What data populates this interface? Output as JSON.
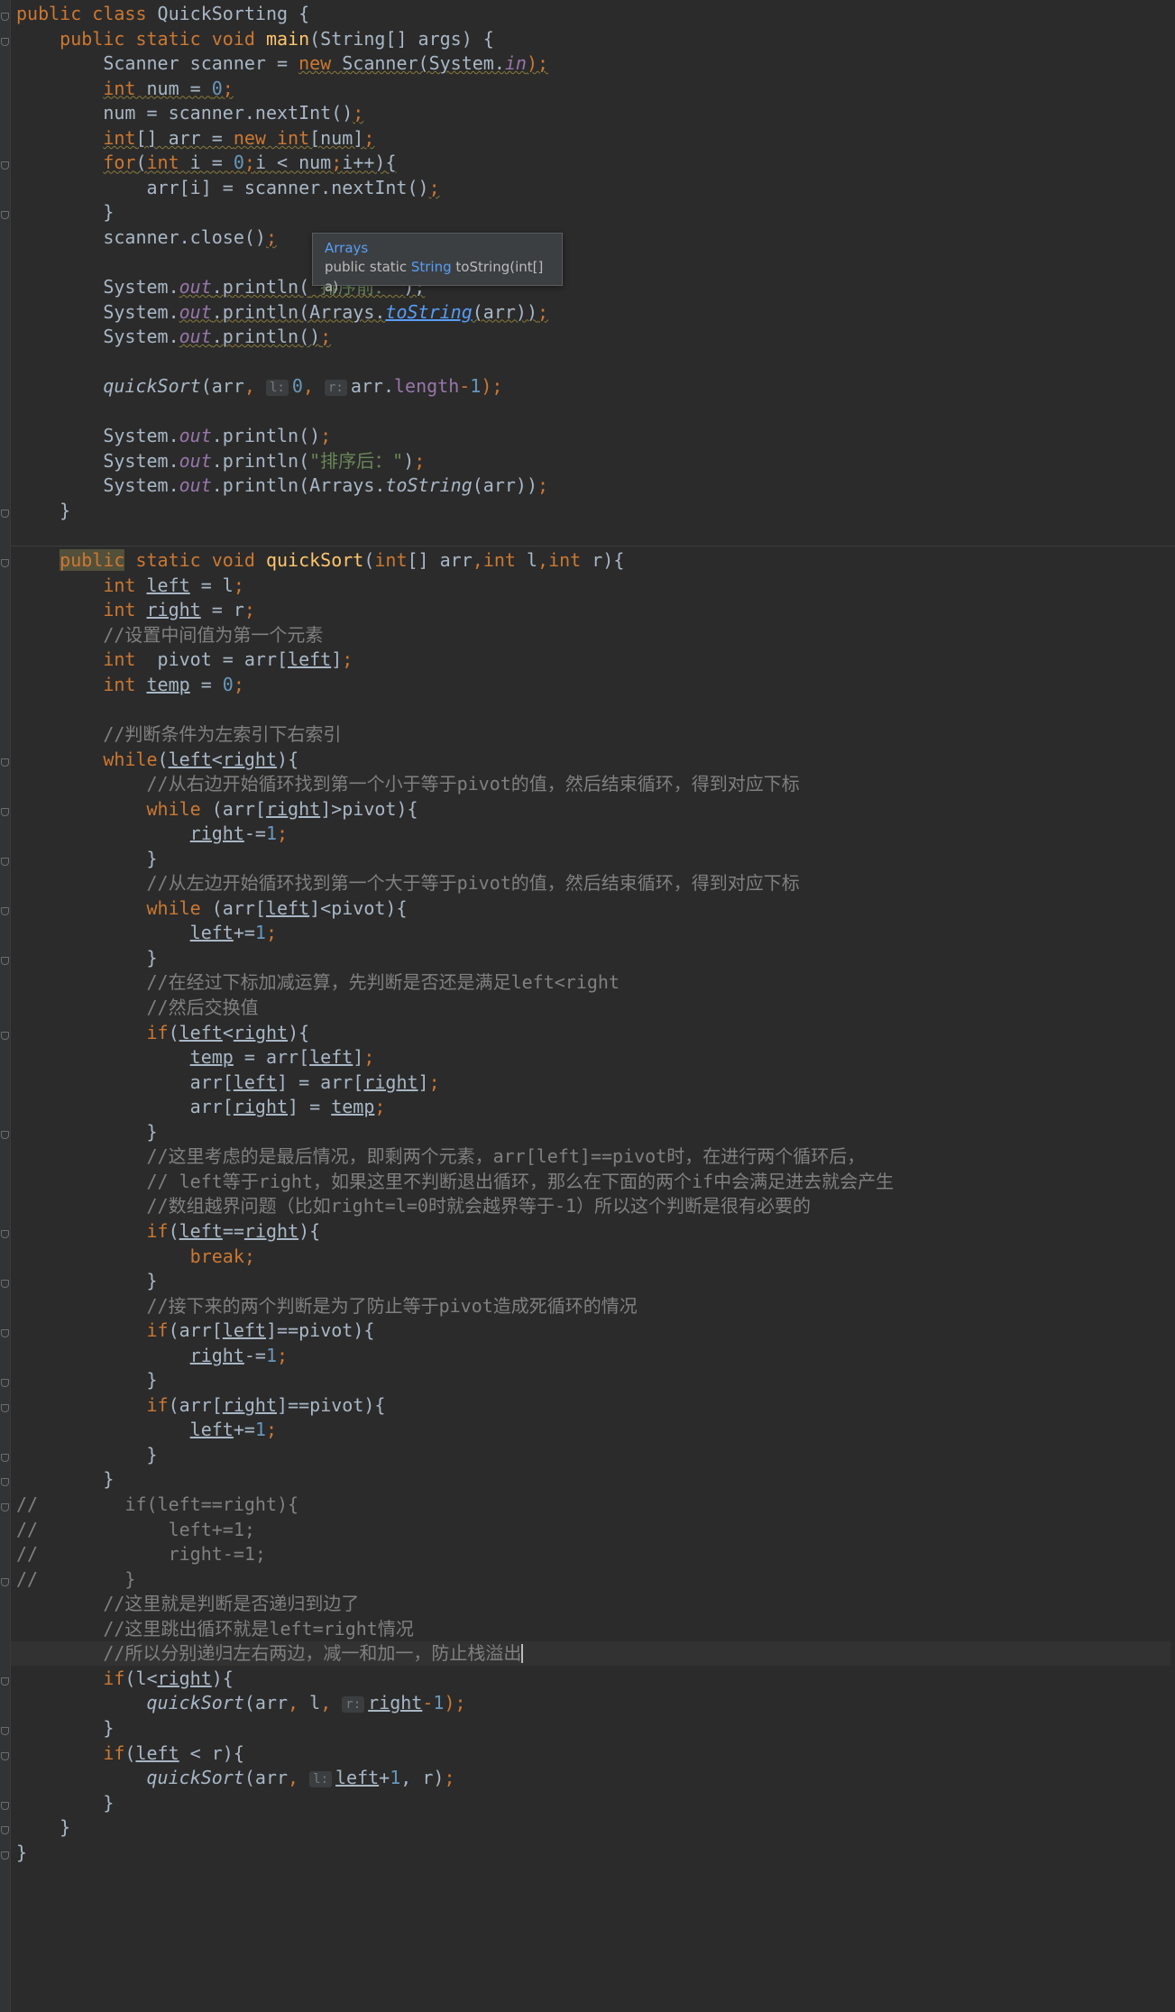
{
  "tooltip": {
    "title": "Arrays",
    "signature_prefix": "public static ",
    "return_type": "String",
    "signature_rest": " toString(int[] a)"
  },
  "gutter_fold_markers": 38,
  "lines": [
    [
      [
        "public class ",
        "kw"
      ],
      [
        "QuickSorting {",
        ""
      ]
    ],
    [
      [
        "    public static void ",
        "kw"
      ],
      [
        "main",
        "fn"
      ],
      [
        "(String[] args) {",
        ""
      ]
    ],
    [
      [
        "        Scanner scanner = ",
        ""
      ],
      [
        "new ",
        "kw"
      ],
      [
        "Scanner(System.",
        ""
      ],
      [
        "in",
        "st"
      ],
      [
        ");",
        "kw"
      ]
    ],
    [
      [
        "        ",
        ""
      ],
      [
        "int ",
        "kw"
      ],
      [
        "num = ",
        ""
      ],
      [
        "0",
        "num"
      ],
      [
        ";",
        "kw"
      ]
    ],
    [
      [
        "        num = scanner.nextInt()",
        ""
      ],
      [
        ";",
        "kw"
      ]
    ],
    [
      [
        "        ",
        ""
      ],
      [
        "int",
        "kw"
      ],
      [
        "[] arr = ",
        ""
      ],
      [
        "new int",
        "kw"
      ],
      [
        "[num]",
        ""
      ],
      [
        ";",
        "kw"
      ]
    ],
    [
      [
        "        ",
        ""
      ],
      [
        "for",
        "kw"
      ],
      [
        "(",
        ""
      ],
      [
        "int ",
        "kw"
      ],
      [
        "i = ",
        ""
      ],
      [
        "0",
        "num"
      ],
      [
        ";",
        "kw"
      ],
      [
        "i < num",
        ""
      ],
      [
        ";",
        "kw"
      ],
      [
        "i++){",
        ""
      ]
    ],
    [
      [
        "            arr[i] = scanner.nextInt()",
        ""
      ],
      [
        ";",
        "kw"
      ]
    ],
    [
      [
        "        }",
        ""
      ]
    ],
    [
      [
        "        scanner.close()",
        ""
      ],
      [
        ";",
        "kw"
      ]
    ],
    [],
    [
      [
        "        System.",
        ""
      ],
      [
        "out",
        "st"
      ],
      [
        ".println(",
        ""
      ],
      [
        "\"排序前：\"",
        "str"
      ],
      [
        ");",
        ""
      ]
    ],
    [
      [
        "        System.",
        ""
      ],
      [
        "out",
        "st"
      ],
      [
        ".println(Arrays.",
        ""
      ],
      [
        "toString",
        "linkfn"
      ],
      [
        "(arr))",
        ""
      ],
      [
        ";",
        "kw"
      ]
    ],
    [
      [
        "        System.",
        ""
      ],
      [
        "out",
        "st"
      ],
      [
        ".println()",
        ""
      ],
      [
        ";",
        "kw"
      ]
    ],
    [],
    [
      [
        "        ",
        ""
      ],
      [
        "quickSort",
        "it"
      ],
      [
        "(arr",
        ""
      ],
      [
        ", ",
        "kw"
      ],
      [
        "l:",
        "hint"
      ],
      [
        "0",
        "num"
      ],
      [
        ", ",
        "kw"
      ],
      [
        "r:",
        "hint"
      ],
      [
        "arr.",
        ""
      ],
      [
        "length",
        "fld"
      ],
      [
        "-",
        "kw"
      ],
      [
        "1",
        "num"
      ],
      [
        ");",
        "kw"
      ]
    ],
    [],
    [
      [
        "        System.",
        ""
      ],
      [
        "out",
        "st"
      ],
      [
        ".println()",
        ""
      ],
      [
        ";",
        "kw"
      ]
    ],
    [
      [
        "        System.",
        ""
      ],
      [
        "out",
        "st"
      ],
      [
        ".println(",
        ""
      ],
      [
        "\"排序后：\"",
        "str"
      ],
      [
        ")",
        ""
      ],
      [
        ";",
        "kw"
      ]
    ],
    [
      [
        "        System.",
        ""
      ],
      [
        "out",
        "st"
      ],
      [
        ".println(Arrays.",
        ""
      ],
      [
        "toString",
        "it"
      ],
      [
        "(arr))",
        ""
      ],
      [
        ";",
        "kw"
      ]
    ],
    [
      [
        "    }",
        ""
      ]
    ],
    [],
    [
      [
        "    ",
        ""
      ],
      [
        "public",
        "kw hlpub"
      ],
      [
        " static void ",
        "kw"
      ],
      [
        "quickSort",
        "fn"
      ],
      [
        "(",
        ""
      ],
      [
        "int",
        "kw"
      ],
      [
        "[] arr",
        ""
      ],
      [
        ",",
        "kw"
      ],
      [
        "int ",
        "kw"
      ],
      [
        "l",
        ""
      ],
      [
        ",",
        "kw"
      ],
      [
        "int ",
        "kw"
      ],
      [
        "r){",
        ""
      ]
    ],
    [
      [
        "        ",
        ""
      ],
      [
        "int ",
        "kw"
      ],
      [
        "left",
        "ul"
      ],
      [
        " = l",
        ""
      ],
      [
        ";",
        "kw"
      ]
    ],
    [
      [
        "        ",
        ""
      ],
      [
        "int ",
        "kw"
      ],
      [
        "right",
        "ul"
      ],
      [
        " = r",
        ""
      ],
      [
        ";",
        "kw"
      ]
    ],
    [
      [
        "        //设置中间值为第一个元素",
        "cm"
      ]
    ],
    [
      [
        "        ",
        ""
      ],
      [
        "int  ",
        "kw"
      ],
      [
        "pivot = arr[",
        ""
      ],
      [
        "left",
        "ul"
      ],
      [
        "]",
        ""
      ],
      [
        ";",
        "kw"
      ]
    ],
    [
      [
        "        ",
        ""
      ],
      [
        "int ",
        "kw"
      ],
      [
        "temp",
        "ul"
      ],
      [
        " = ",
        ""
      ],
      [
        "0",
        "num"
      ],
      [
        ";",
        "kw"
      ]
    ],
    [],
    [
      [
        "        //判断条件为左索引下右索引",
        "cm"
      ]
    ],
    [
      [
        "        ",
        ""
      ],
      [
        "while",
        "kw"
      ],
      [
        "(",
        ""
      ],
      [
        "left",
        "ul"
      ],
      [
        "<",
        ""
      ],
      [
        "right",
        "ul"
      ],
      [
        "){",
        ""
      ]
    ],
    [
      [
        "            //从右边开始循环找到第一个小于等于pivot的值，然后结束循环，得到对应下标",
        "cm"
      ]
    ],
    [
      [
        "            ",
        ""
      ],
      [
        "while ",
        "kw"
      ],
      [
        "(arr[",
        ""
      ],
      [
        "right",
        "ul"
      ],
      [
        "]>pivot){",
        ""
      ]
    ],
    [
      [
        "                ",
        ""
      ],
      [
        "right",
        "ul"
      ],
      [
        "-=",
        ""
      ],
      [
        "1",
        "num"
      ],
      [
        ";",
        "kw"
      ]
    ],
    [
      [
        "            }",
        ""
      ]
    ],
    [
      [
        "            //从左边开始循环找到第一个大于等于pivot的值，然后结束循环，得到对应下标",
        "cm"
      ]
    ],
    [
      [
        "            ",
        ""
      ],
      [
        "while ",
        "kw"
      ],
      [
        "(arr[",
        ""
      ],
      [
        "left",
        "ul"
      ],
      [
        "]<pivot){",
        ""
      ]
    ],
    [
      [
        "                ",
        ""
      ],
      [
        "left",
        "ul"
      ],
      [
        "+=",
        ""
      ],
      [
        "1",
        "num"
      ],
      [
        ";",
        "kw"
      ]
    ],
    [
      [
        "            }",
        ""
      ]
    ],
    [
      [
        "            //在经过下标加减运算，先判断是否还是满足left<right",
        "cm"
      ]
    ],
    [
      [
        "            //然后交换值",
        "cm"
      ]
    ],
    [
      [
        "            ",
        ""
      ],
      [
        "if",
        "kw"
      ],
      [
        "(",
        ""
      ],
      [
        "left",
        "ul"
      ],
      [
        "<",
        ""
      ],
      [
        "right",
        "ul"
      ],
      [
        "){",
        ""
      ]
    ],
    [
      [
        "                ",
        ""
      ],
      [
        "temp",
        "ul"
      ],
      [
        " = arr[",
        ""
      ],
      [
        "left",
        "ul"
      ],
      [
        "]",
        ""
      ],
      [
        ";",
        "kw"
      ]
    ],
    [
      [
        "                arr[",
        ""
      ],
      [
        "left",
        "ul"
      ],
      [
        "] = arr[",
        ""
      ],
      [
        "right",
        "ul"
      ],
      [
        "]",
        ""
      ],
      [
        ";",
        "kw"
      ]
    ],
    [
      [
        "                arr[",
        ""
      ],
      [
        "right",
        "ul"
      ],
      [
        "] = ",
        ""
      ],
      [
        "temp",
        "ul"
      ],
      [
        ";",
        "kw"
      ]
    ],
    [
      [
        "            }",
        ""
      ]
    ],
    [
      [
        "            //这里考虑的是最后情况，即剩两个元素，arr[left]==pivot时，在进行两个循环后，",
        "cm"
      ]
    ],
    [
      [
        "            // left等于right，如果这里不判断退出循环，那么在下面的两个if中会满足进去就会产生",
        "cm"
      ]
    ],
    [
      [
        "            //数组越界问题（比如right=l=0时就会越界等于-1）所以这个判断是很有必要的",
        "cm"
      ]
    ],
    [
      [
        "            ",
        ""
      ],
      [
        "if",
        "kw"
      ],
      [
        "(",
        ""
      ],
      [
        "left",
        "ul"
      ],
      [
        "==",
        ""
      ],
      [
        "right",
        "ul"
      ],
      [
        "){",
        ""
      ]
    ],
    [
      [
        "                ",
        ""
      ],
      [
        "break;",
        "kw"
      ]
    ],
    [
      [
        "            }",
        ""
      ]
    ],
    [
      [
        "            //接下来的两个判断是为了防止等于pivot造成死循环的情况",
        "cm"
      ]
    ],
    [
      [
        "            ",
        ""
      ],
      [
        "if",
        "kw"
      ],
      [
        "(arr[",
        ""
      ],
      [
        "left",
        "ul"
      ],
      [
        "]==pivot){",
        ""
      ]
    ],
    [
      [
        "                ",
        ""
      ],
      [
        "right",
        "ul"
      ],
      [
        "-=",
        ""
      ],
      [
        "1",
        "num"
      ],
      [
        ";",
        "kw"
      ]
    ],
    [
      [
        "            }",
        ""
      ]
    ],
    [
      [
        "            ",
        ""
      ],
      [
        "if",
        "kw"
      ],
      [
        "(arr[",
        ""
      ],
      [
        "right",
        "ul"
      ],
      [
        "]==pivot){",
        ""
      ]
    ],
    [
      [
        "                ",
        ""
      ],
      [
        "left",
        "ul"
      ],
      [
        "+=",
        ""
      ],
      [
        "1",
        "num"
      ],
      [
        ";",
        "kw"
      ]
    ],
    [
      [
        "            }",
        ""
      ]
    ],
    [
      [
        "        }",
        ""
      ]
    ],
    [
      [
        "//        if(left==right){",
        "cm"
      ]
    ],
    [
      [
        "//            left+=1;",
        "cm"
      ]
    ],
    [
      [
        "//            right-=1;",
        "cm"
      ]
    ],
    [
      [
        "//        }",
        "cm"
      ]
    ],
    [
      [
        "        //这里就是判断是否递归到边了",
        "cm"
      ]
    ],
    [
      [
        "        //这里跳出循环就是left=right情况",
        "cm"
      ]
    ],
    [
      [
        "        //所以分别递归左右两边，减一和加一，防止栈溢出",
        "cm"
      ]
    ],
    [
      [
        "        ",
        ""
      ],
      [
        "if",
        "kw"
      ],
      [
        "(l<",
        ""
      ],
      [
        "right",
        "ul"
      ],
      [
        "){",
        ""
      ]
    ],
    [
      [
        "            ",
        ""
      ],
      [
        "quickSort",
        "it"
      ],
      [
        "(arr",
        ""
      ],
      [
        ", ",
        "kw"
      ],
      [
        "l",
        ""
      ],
      [
        ", ",
        "kw"
      ],
      [
        "r:",
        "hint"
      ],
      [
        "right",
        "ul"
      ],
      [
        "-",
        "kw"
      ],
      [
        "1",
        "num"
      ],
      [
        ");",
        "kw"
      ]
    ],
    [
      [
        "        }",
        ""
      ]
    ],
    [
      [
        "        ",
        ""
      ],
      [
        "if",
        "kw"
      ],
      [
        "(",
        ""
      ],
      [
        "left",
        "ul"
      ],
      [
        " < r){",
        ""
      ]
    ],
    [
      [
        "            ",
        ""
      ],
      [
        "quickSort",
        "it"
      ],
      [
        "(arr",
        ""
      ],
      [
        ", ",
        "kw"
      ],
      [
        "l:",
        "hint"
      ],
      [
        "left",
        "ul"
      ],
      [
        "+",
        ""
      ],
      [
        "1",
        "num"
      ],
      [
        ", r)",
        ""
      ],
      [
        ";",
        "kw"
      ]
    ],
    [
      [
        "        }",
        ""
      ]
    ],
    [
      [
        "    }",
        ""
      ]
    ],
    [
      [
        "}",
        ""
      ]
    ]
  ]
}
